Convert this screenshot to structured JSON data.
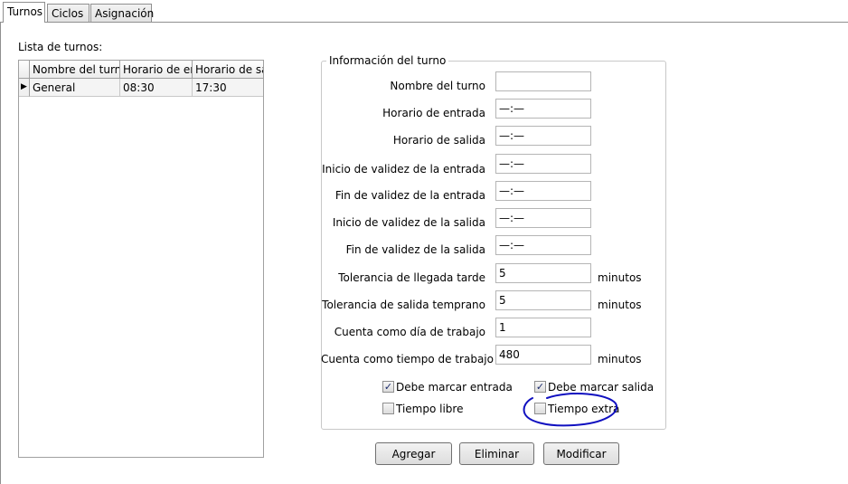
{
  "tabs": [
    "Turnos",
    "Ciclos",
    "Asignación"
  ],
  "list": {
    "title": "Lista de turnos:",
    "columns": [
      "Nombre del turno",
      "Horario de ent",
      "Horario de sal"
    ],
    "rows": [
      {
        "selected_marker": "▶",
        "cells": [
          "General",
          "08:30",
          "17:30"
        ]
      }
    ]
  },
  "info": {
    "title": "Información del turno",
    "fields": [
      {
        "label": "Nombre del turno",
        "value": "",
        "unit": ""
      },
      {
        "label": "Horario de entrada",
        "value": "—:—",
        "unit": ""
      },
      {
        "label": "Horario de salida",
        "value": "—:—",
        "unit": ""
      },
      {
        "label": "Inicio de validez de la entrada",
        "value": "—:—",
        "unit": ""
      },
      {
        "label": "Fin de validez de la entrada",
        "value": "—:—",
        "unit": ""
      },
      {
        "label": "Inicio de validez de la salida",
        "value": "—:—",
        "unit": ""
      },
      {
        "label": "Fin de validez de la salida",
        "value": "—:—",
        "unit": ""
      },
      {
        "label": "Tolerancia de llegada tarde",
        "value": "5",
        "unit": "minutos"
      },
      {
        "label": "Tolerancia de salida temprano",
        "value": "5",
        "unit": "minutos"
      },
      {
        "label": "Cuenta como día de trabajo",
        "value": "1",
        "unit": ""
      },
      {
        "label": "Cuenta como tiempo de trabajo",
        "value": "480",
        "unit": "minutos"
      }
    ],
    "checkboxes": [
      {
        "label": "Debe marcar entrada",
        "checked": true
      },
      {
        "label": "Debe marcar salida",
        "checked": true
      },
      {
        "label": "Tiempo libre",
        "checked": false
      },
      {
        "label": "Tiempo extra",
        "checked": false
      }
    ]
  },
  "buttons": {
    "add": "Agregar",
    "delete": "Eliminar",
    "modify": "Modificar"
  },
  "check_mark": "✓",
  "colors": {
    "annotation_circle": "#1010c0",
    "check": "#1a2a6c"
  }
}
